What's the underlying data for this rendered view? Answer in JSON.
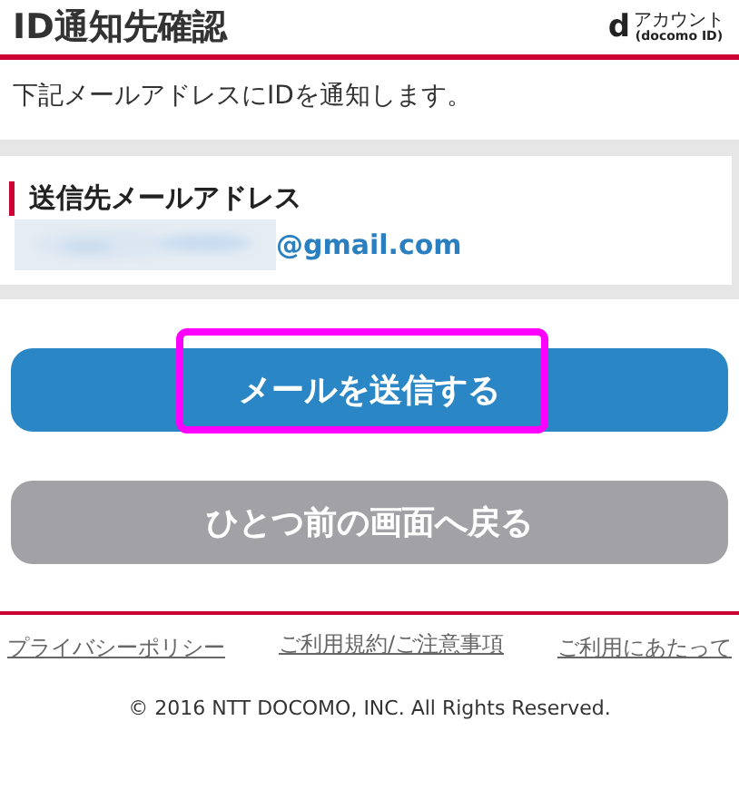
{
  "header": {
    "title": "ID通知先確認",
    "logo": {
      "mark": "d",
      "line1": "アカウント",
      "line2": "(docomo ID)"
    }
  },
  "intro": "下記メールアドレスにIDを通知します。",
  "recipient": {
    "label": "送信先メールアドレス",
    "email_visible": "@gmail.com",
    "redacted": true
  },
  "buttons": [
    {
      "label": "メールを送信する",
      "kind": "primary",
      "highlighted": true
    },
    {
      "label": "ひとつ前の画面へ戻る",
      "kind": "secondary",
      "highlighted": false
    }
  ],
  "footer": {
    "links": [
      "プライバシーポリシー",
      "ご利用規約/ご注意事項",
      "ご利用にあたって"
    ],
    "copyright": "© 2016 NTT DOCOMO, INC. All Rights Reserved."
  }
}
